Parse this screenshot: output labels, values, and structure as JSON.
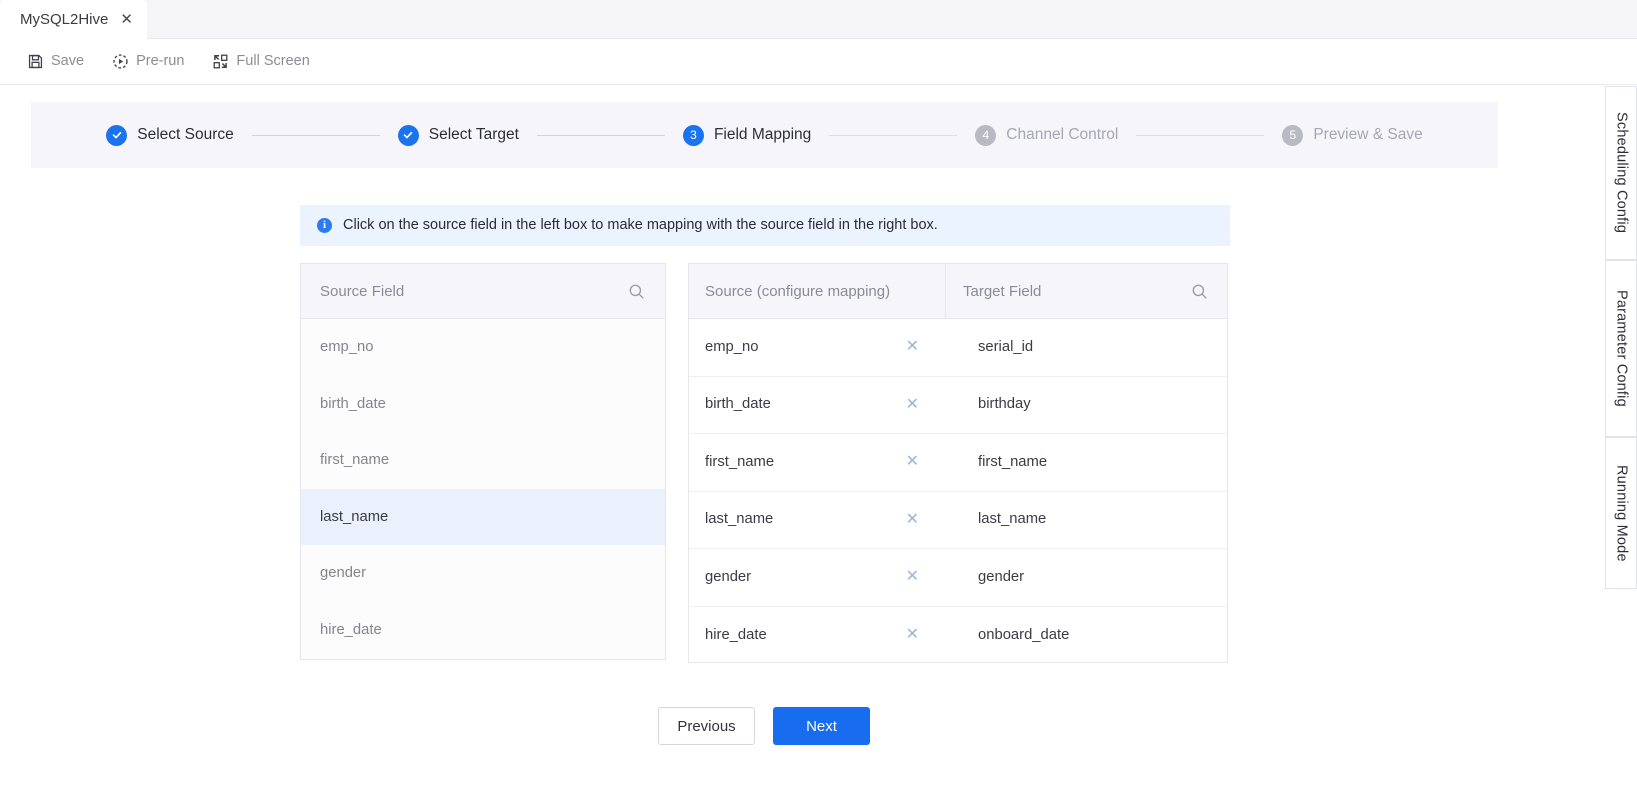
{
  "tab": {
    "label": "MySQL2Hive",
    "close_icon": "close-icon",
    "close_glyph": "✕"
  },
  "toolbar": {
    "items": [
      {
        "label": "Save",
        "icon": "save-icon"
      },
      {
        "label": "Pre-run",
        "icon": "play-circle-dashed-icon"
      },
      {
        "label": "Full Screen",
        "icon": "fullscreen-icon"
      }
    ]
  },
  "stepper": {
    "steps": [
      {
        "num": "1",
        "label": "Select Source",
        "state": "done",
        "badge": "check"
      },
      {
        "num": "2",
        "label": "Select Target",
        "state": "done",
        "badge": "check"
      },
      {
        "num": "3",
        "label": "Field Mapping",
        "state": "active",
        "badge": "3"
      },
      {
        "num": "4",
        "label": "Channel Control",
        "state": "todo",
        "badge": "4"
      },
      {
        "num": "5",
        "label": "Preview & Save",
        "state": "todo",
        "badge": "5"
      }
    ]
  },
  "banner": {
    "icon": "info-icon",
    "icon_glyph": "i",
    "text": "Click on the source field in the left box to make mapping with the source field in the right box."
  },
  "source_panel": {
    "header": "Source Field",
    "search_icon": "search-icon",
    "items": [
      {
        "name": "emp_no",
        "selected": false
      },
      {
        "name": "birth_date",
        "selected": false
      },
      {
        "name": "first_name",
        "selected": false
      },
      {
        "name": "last_name",
        "selected": true
      },
      {
        "name": "gender",
        "selected": false
      },
      {
        "name": "hire_date",
        "selected": false
      }
    ]
  },
  "mapping_panel": {
    "header_source": "Source (configure mapping)",
    "header_target": "Target Field",
    "search_icon": "search-icon",
    "remove_glyph": "✕",
    "rows": [
      {
        "source": "emp_no",
        "target": "serial_id"
      },
      {
        "source": "birth_date",
        "target": "birthday"
      },
      {
        "source": "first_name",
        "target": "first_name"
      },
      {
        "source": "last_name",
        "target": "last_name"
      },
      {
        "source": "gender",
        "target": "gender"
      },
      {
        "source": "hire_date",
        "target": "onboard_date"
      }
    ]
  },
  "footer": {
    "previous_label": "Previous",
    "next_label": "Next"
  },
  "side_rail": {
    "tabs": [
      {
        "label": "Scheduling Config"
      },
      {
        "label": "Parameter Config"
      },
      {
        "label": "Running Mode"
      }
    ]
  },
  "colors": {
    "accent": "#186cf0",
    "step_done": "#1a73ef",
    "step_todo": "#b9b9c4",
    "banner_bg": "#eaf3fe",
    "selected_row_bg": "#eaf1fd",
    "panel_header_bg": "#f6f6fa"
  }
}
